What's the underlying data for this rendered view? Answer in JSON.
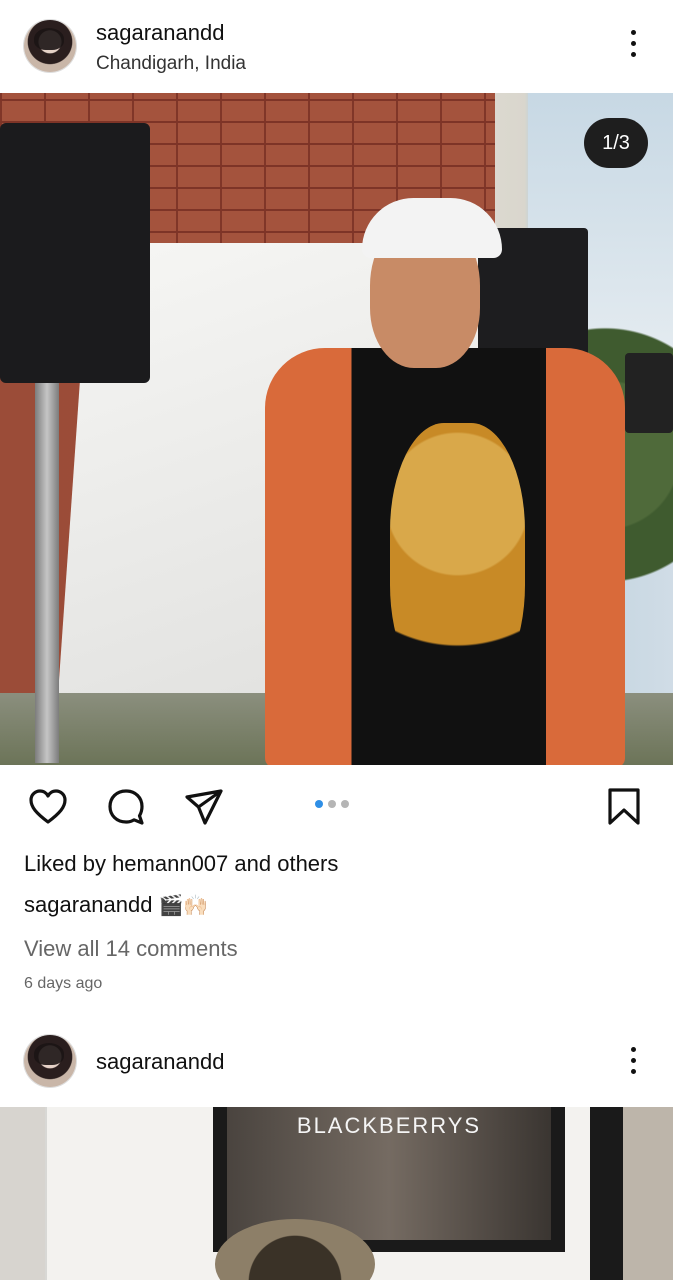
{
  "posts": [
    {
      "username": "sagaranandd",
      "location": "Chandigarh, India",
      "page_counter": "1/3",
      "carousel": {
        "total": 3,
        "active_index": 0
      },
      "likes": {
        "prefix": "Liked by ",
        "user": "hemann007",
        "middle": " and ",
        "suffix": "others"
      },
      "caption": {
        "username": "sagaranandd",
        "emoji": "🎬🙌🏻"
      },
      "comments_link": "View all 14 comments",
      "time": "6 days ago"
    },
    {
      "username": "sagaranandd",
      "photo_sign": "BLACKBERRYS"
    }
  ],
  "colors": {
    "accent_dot": "#2f8fe6",
    "inactive_dot": "#b5b5b5",
    "text": "#111111",
    "muted": "#666666"
  },
  "icons": [
    "heart-icon",
    "comment-icon",
    "share-icon",
    "bookmark-icon",
    "more-options-icon"
  ]
}
